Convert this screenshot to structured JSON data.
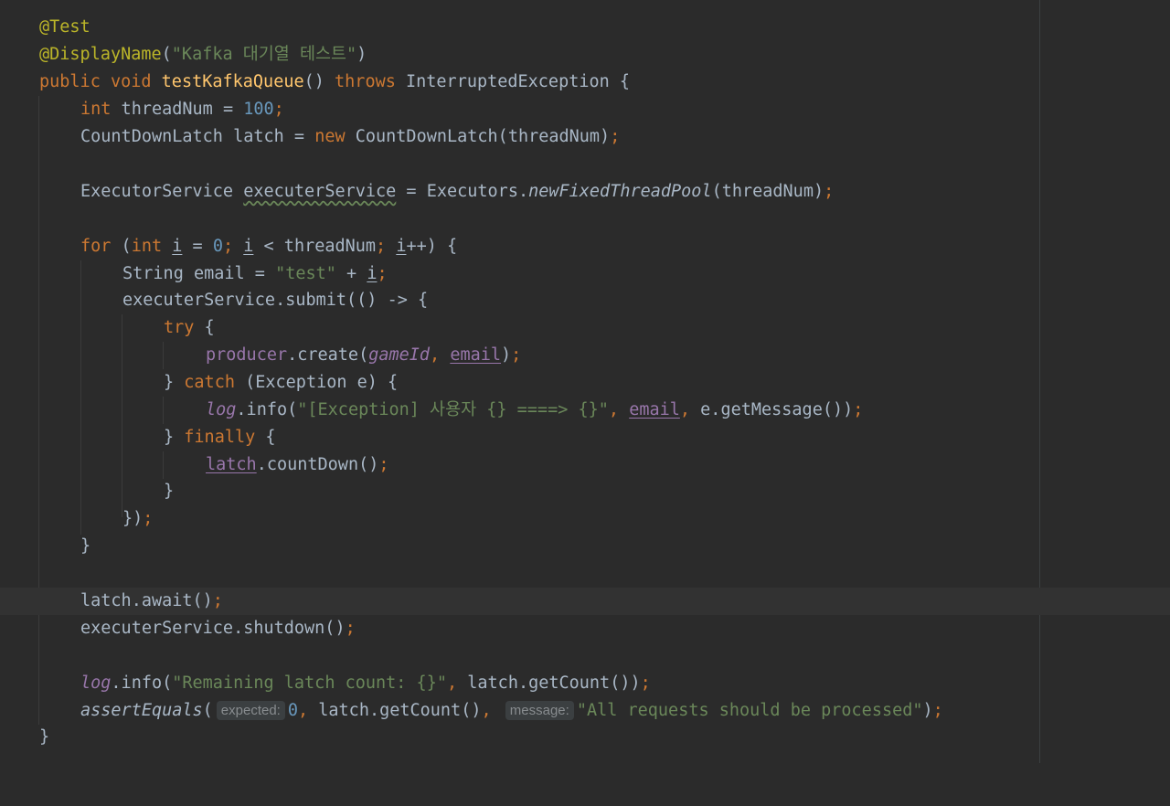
{
  "editor": {
    "line1": {
      "annotation": "@Test"
    },
    "line2": {
      "annotation": "@DisplayName",
      "open": "(",
      "string": "\"Kafka 대기열 테스트\"",
      "close": ")"
    },
    "line3": {
      "kw1": "public",
      "kw2": "void",
      "method": "testKafkaQueue",
      "paren": "()",
      "kw3": "throws",
      "rest": "InterruptedException {"
    },
    "line4": {
      "kw": "int",
      "text": " threadNum = ",
      "num": "100",
      "semi": ";"
    },
    "line5": {
      "text": "CountDownLatch latch = ",
      "kw": "new",
      "rest": " CountDownLatch(threadNum)",
      "semi": ";"
    },
    "line7": {
      "t1": "ExecutorService ",
      "var": "executerService",
      "t2": " = Executors.",
      "call": "newFixedThreadPool",
      "t3": "(threadNum)",
      "semi": ";"
    },
    "line9": {
      "kw_for": "for",
      "p1": " (",
      "kw_int": "int",
      "sp1": " ",
      "i1": "i",
      "eq": " = ",
      "zero": "0",
      "semi1": ";",
      "sp2": " ",
      "i2": "i",
      "lt": " < threadNum",
      "semi2": ";",
      "sp3": " ",
      "i3": "i",
      "rest": "++) {"
    },
    "line10": {
      "t1": "String email = ",
      "str": "\"test\"",
      "plus": " + ",
      "i": "i",
      "semi": ";"
    },
    "line11": {
      "text": "executerService.submit(() -> {"
    },
    "line12": {
      "kw": "try",
      "rest": " {"
    },
    "line13": {
      "field": "producer",
      "t1": ".create(",
      "p1": "gameId",
      "comma": ", ",
      "p2": "email",
      "t2": ")",
      "semi": ";"
    },
    "line14": {
      "brace": "} ",
      "kw": "catch",
      "rest": " (Exception e) {"
    },
    "line15": {
      "field": "log",
      "t1": ".info(",
      "str": "\"[Exception] 사용자 {} ====> {}\"",
      "comma1": ", ",
      "email": "email",
      "comma2": ", ",
      "t2": "e.getMessage())",
      "semi": ";"
    },
    "line16": {
      "brace": "} ",
      "kw": "finally",
      "rest": " {"
    },
    "line17": {
      "var": "latch",
      "t1": ".countDown()",
      "semi": ";"
    },
    "line18": {
      "text": "}"
    },
    "line19": {
      "text": "})",
      "semi": ";"
    },
    "line20": {
      "text": "}"
    },
    "line22": {
      "text": "latch.await()",
      "semi": ";"
    },
    "line23": {
      "text": "executerService.shutdown()",
      "semi": ";"
    },
    "line25": {
      "field": "log",
      "t1": ".info(",
      "str": "\"Remaining latch count: {}\"",
      "comma": ", ",
      "t2": "latch.getCount())",
      "semi": ";"
    },
    "line26": {
      "call": "assertEquals",
      "t1": "(",
      "hint1": "expected:",
      "num": "0",
      "comma1": ", ",
      "t2": "latch.getCount()",
      "comma2": ", ",
      "hint2": "message:",
      "str": "\"All requests should be processed\"",
      "t3": ")",
      "semi": ";"
    },
    "line27": {
      "text": "}"
    }
  }
}
